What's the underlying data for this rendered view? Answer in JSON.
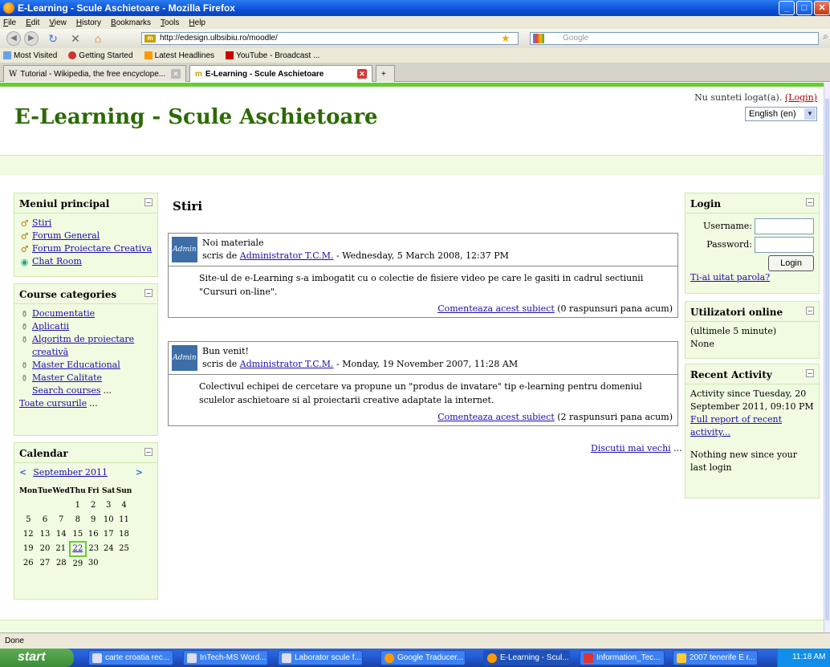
{
  "window": {
    "title": "E-Learning - Scule Aschietoare - Mozilla Firefox"
  },
  "menubar": [
    "File",
    "Edit",
    "View",
    "History",
    "Bookmarks",
    "Tools",
    "Help"
  ],
  "navbar": {
    "url": "http://edesign.ulbsibiu.ro/moodle/",
    "search_placeholder": "Google"
  },
  "bookmarks": [
    "Most Visited",
    "Getting Started",
    "Latest Headlines",
    "YouTube - Broadcast ..."
  ],
  "tabs": [
    {
      "label": "Tutorial - Wikipedia, the free encyclope..."
    },
    {
      "label": "E-Learning - Scule Aschietoare"
    }
  ],
  "page": {
    "site_title": "E-Learning - Scule Aschietoare",
    "login_status": "Nu sunteti logat(a).",
    "login_link": "(Login)",
    "language": "English (en)",
    "main_menu": {
      "title": "Meniul principal",
      "items": [
        "Stiri",
        "Forum General",
        "Forum Proiectare Creativa",
        "Chat Room"
      ]
    },
    "course_categories": {
      "title": "Course categories",
      "items": [
        "Documentatie",
        "Aplicatii",
        "Algoritm de proiectare",
        "creativă",
        "Master Educational",
        "Master Calitate"
      ],
      "search": "Search courses",
      "all": "Toate cursurile"
    },
    "calendar": {
      "title": "Calendar",
      "month": "September 2011",
      "weekdays": [
        "Mon",
        "Tue",
        "Wed",
        "Thu",
        "Fri",
        "Sat",
        "Sun"
      ],
      "weeks": [
        [
          "",
          "",
          "",
          "1",
          "2",
          "3",
          "4"
        ],
        [
          "5",
          "6",
          "7",
          "8",
          "9",
          "10",
          "11"
        ],
        [
          "12",
          "13",
          "14",
          "15",
          "16",
          "17",
          "18"
        ],
        [
          "19",
          "20",
          "21",
          "22",
          "23",
          "24",
          "25"
        ],
        [
          "26",
          "27",
          "28",
          "29",
          "30",
          "",
          ""
        ]
      ],
      "today": "22"
    },
    "news": {
      "heading": "Stiri",
      "posts": [
        {
          "title": "Noi materiale",
          "by": "scris de",
          "author": "Administrator T.C.M.",
          "date": "- Wednesday, 5 March 2008, 12:37 PM",
          "body": "Site-ul de e-Learning s-a imbogatit cu o colectie de fisiere video pe care le gasiti in cadrul sectiunii \"Cursuri on-line\".",
          "comment_link": "Comenteaza acest subiect",
          "comment_count": "(0 raspunsuri pana acum)"
        },
        {
          "title": "Bun venit!",
          "by": "scris de",
          "author": "Administrator T.C.M.",
          "date": "- Monday, 19 November 2007, 11:28 AM",
          "body": "Colectivul echipei de cercetare va propune un \"produs de invatare\" tip e-learning pentru domeniul sculelor aschietoare si al proiectarii creative adaptate la internet.",
          "comment_link": "Comenteaza acest subiect",
          "comment_count": "(2 raspunsuri pana acum)"
        }
      ],
      "older": "Discutii mai vechi"
    },
    "login_block": {
      "title": "Login",
      "username_label": "Username:",
      "password_label": "Password:",
      "button": "Login",
      "forgot": "Ti-ai uitat parola?"
    },
    "online_block": {
      "title": "Utilizatori online",
      "period": "(ultimele 5 minute)",
      "none": "None"
    },
    "activity_block": {
      "title": "Recent Activity",
      "since": "Activity since Tuesday, 20 September 2011, 09:10 PM",
      "report": "Full report of recent activity...",
      "nothing": "Nothing new since your last login"
    }
  },
  "status": "Done",
  "taskbar": {
    "start": "start",
    "tasks": [
      "carte croatia rec...",
      "InTech-MS Word...",
      "Laborator scule f...",
      "Google Traducer...",
      "E-Learning - Scul...",
      "Information_Tec...",
      "2007 tenerife E r..."
    ],
    "clock": "11:18 AM"
  }
}
